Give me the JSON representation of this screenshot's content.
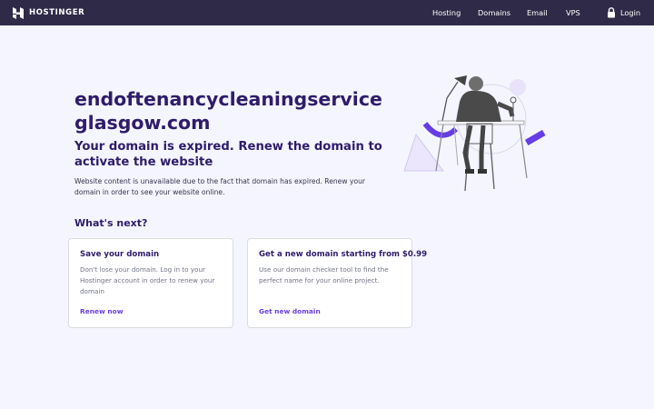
{
  "navbar": {
    "brand": "HOSTINGER",
    "links": [
      "Hosting",
      "Domains",
      "Email",
      "VPS"
    ],
    "login_label": "Login"
  },
  "main": {
    "domain": "endoftenancycleaningserviceglasgow.com",
    "headline": "Your domain is expired. Renew the domain to activate the website",
    "description": "Website content is unavailable due to the fact that domain has expired. Renew your domain in order to see your website online.",
    "next_heading": "What's next?"
  },
  "cards": [
    {
      "title": "Save your domain",
      "text": "Don't lose your domain. Log in to your Hostinger account in order to renew your domain",
      "link": "Renew now"
    },
    {
      "title": "Get a new domain starting from $0.99",
      "text": "Use our domain checker tool to find the perfect name for your online project.",
      "link": "Get new domain"
    }
  ],
  "colors": {
    "navbar_bg": "#2f2a47",
    "heading": "#2f1c6a",
    "accent": "#673de6",
    "page_bg": "#f4f5ff"
  },
  "icons": [
    "hostinger-logo-icon",
    "lock-icon",
    "illustration"
  ]
}
